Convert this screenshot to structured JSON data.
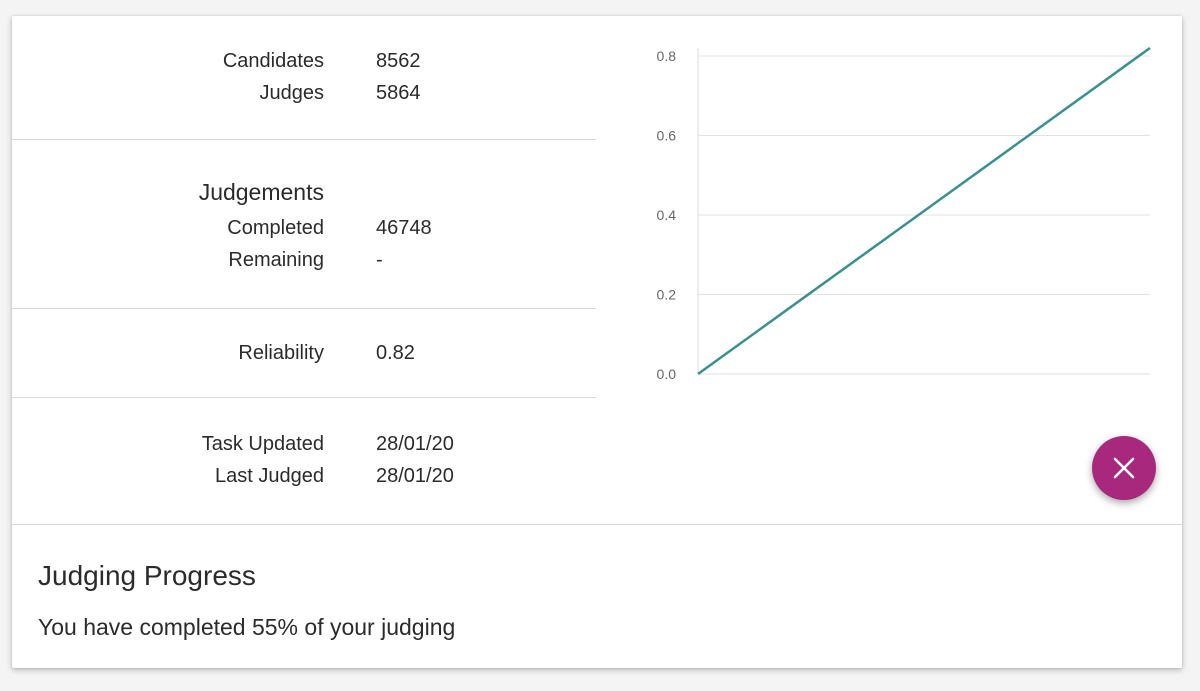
{
  "stats": {
    "candidates_label": "Candidates",
    "candidates_value": "8562",
    "judges_label": "Judges",
    "judges_value": "5864",
    "judgements_title": "Judgements",
    "completed_label": "Completed",
    "completed_value": "46748",
    "remaining_label": "Remaining",
    "remaining_value": "-",
    "reliability_label": "Reliability",
    "reliability_value": "0.82",
    "task_updated_label": "Task Updated",
    "task_updated_value": "28/01/20",
    "last_judged_label": "Last Judged",
    "last_judged_value": "28/01/20"
  },
  "chart_data": {
    "type": "line",
    "x": [
      0,
      1
    ],
    "series": [
      {
        "values": [
          0.0,
          0.82
        ]
      }
    ],
    "ytick_labels": [
      "0.0",
      "0.2",
      "0.4",
      "0.6",
      "0.8"
    ],
    "yticks": [
      0,
      0.2,
      0.4,
      0.6,
      0.8
    ],
    "ylim": [
      0,
      0.82
    ],
    "grid": true,
    "line_color": "#3a8f8f"
  },
  "fab": {
    "icon": "close-icon",
    "color": "#a8287e"
  },
  "progress": {
    "title": "Judging Progress",
    "text": "You have completed 55% of your judging",
    "percent": 55
  }
}
